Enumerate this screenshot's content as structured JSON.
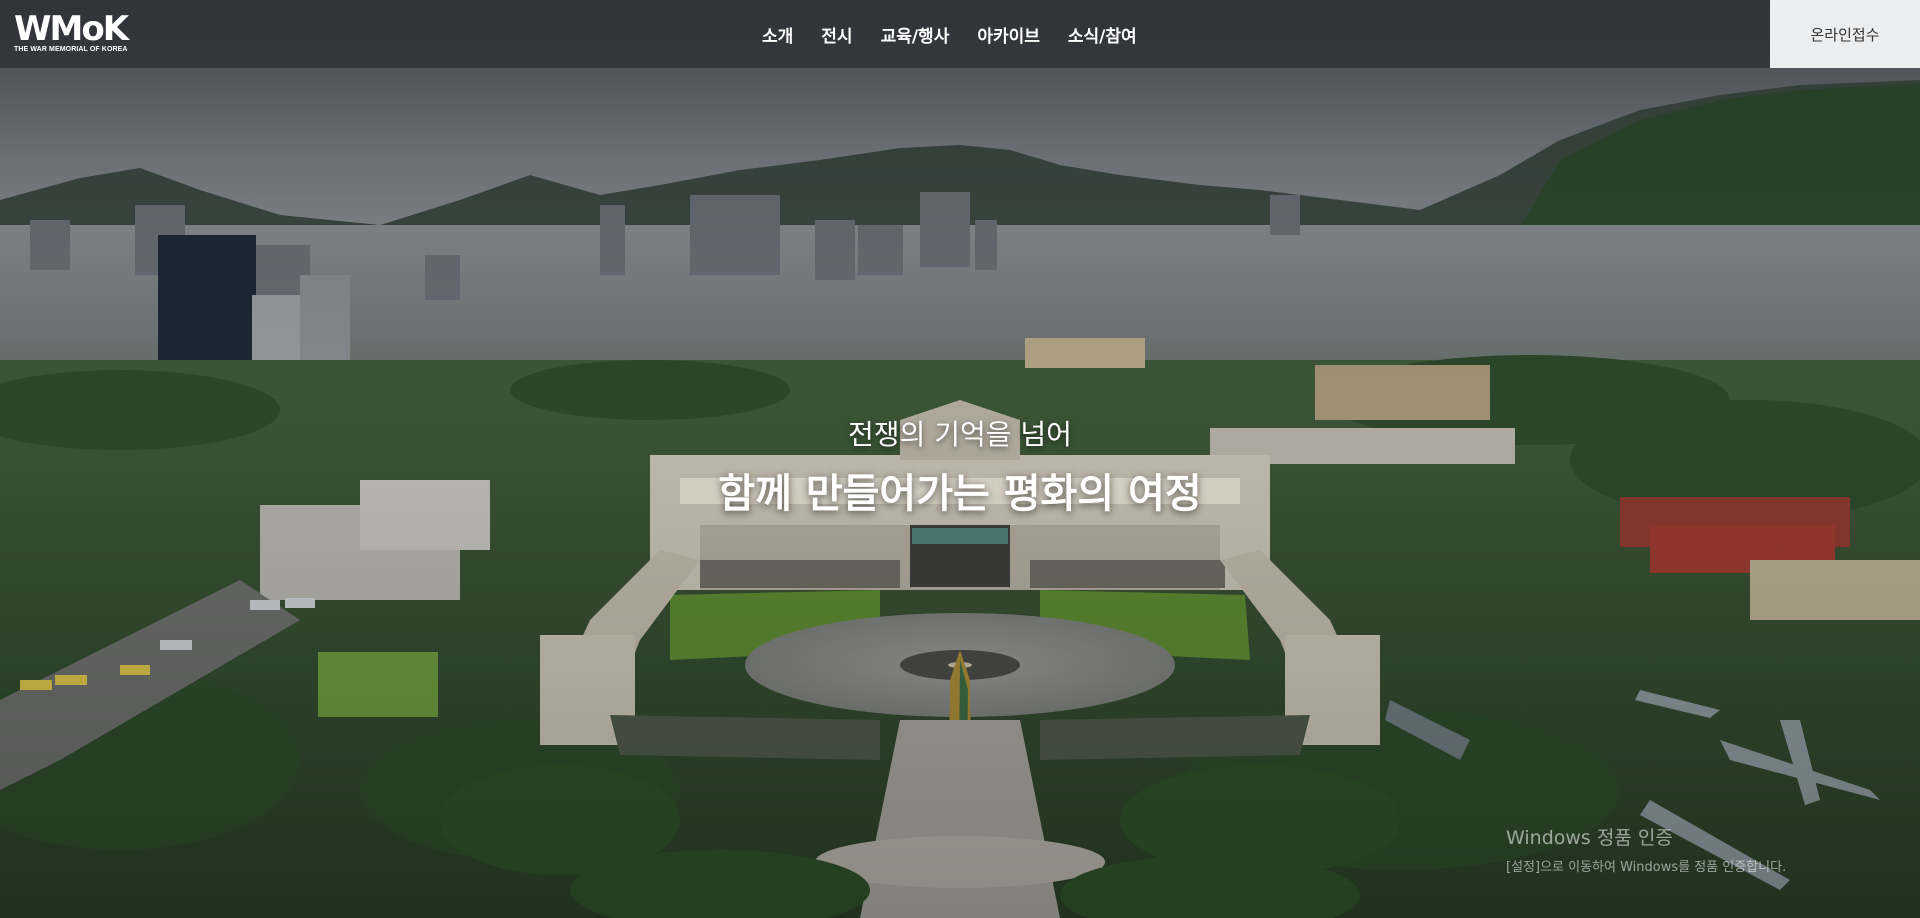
{
  "logo": {
    "mark": "WMoK",
    "subtitle": "THE WAR MEMORIAL OF KOREA"
  },
  "nav": {
    "items": [
      {
        "label": "소개"
      },
      {
        "label": "전시"
      },
      {
        "label": "교육/행사"
      },
      {
        "label": "아카이브"
      },
      {
        "label": "소식/참여"
      }
    ],
    "online_button": "온라인접수"
  },
  "hero": {
    "subtitle": "전쟁의 기억을 넘어",
    "title": "함께 만들어가는 평화의 여정"
  },
  "watermark": {
    "line1": "Windows 정품 인증",
    "line2": "[설정]으로 이동하여 Windows를 정품 인증합니다."
  },
  "colors": {
    "topbar": "#2d3034",
    "online_button_bg": "#ecedee",
    "text_light": "#ffffff"
  }
}
